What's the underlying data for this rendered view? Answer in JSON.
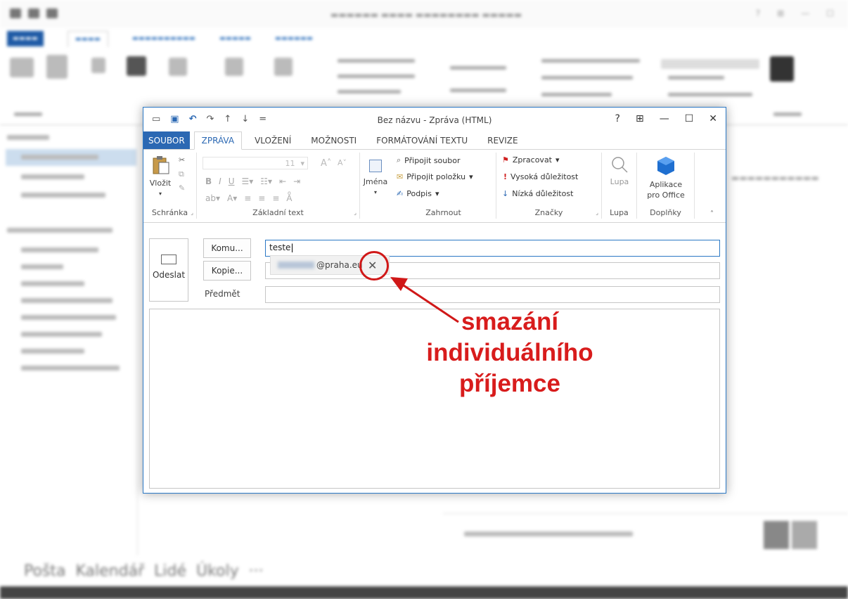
{
  "message_window": {
    "title": "Bez názvu - Zpráva (HTML)",
    "controls": {
      "help": "?",
      "ribbon_display": "⊞",
      "minimize": "—",
      "maximize": "☐",
      "close": "✕"
    },
    "tabs": [
      {
        "label": "SOUBOR",
        "active": false
      },
      {
        "label": "ZPRÁVA",
        "active": true
      },
      {
        "label": "VLOŽENÍ",
        "active": false
      },
      {
        "label": "MOŽNOSTI",
        "active": false
      },
      {
        "label": "FORMÁTOVÁNÍ TEXTU",
        "active": false
      },
      {
        "label": "REVIZE",
        "active": false
      }
    ],
    "ribbon": {
      "clipboard": {
        "label": "Schránka",
        "paste": "Vložit"
      },
      "basic_text": {
        "label": "Základní text",
        "font_size": "11"
      },
      "names": {
        "label": "Jména"
      },
      "include": {
        "label": "Zahrnout",
        "attach_file": "Připojit soubor",
        "attach_item": "Připojit položku",
        "signature": "Podpis"
      },
      "tags": {
        "label": "Značky",
        "follow_up": "Zpracovat",
        "high_importance": "Vysoká důležitost",
        "low_importance": "Nízká důležitost"
      },
      "zoom": {
        "label": "Lupa",
        "button": "Lupa"
      },
      "addins": {
        "label": "Doplňky",
        "apps_line1": "Aplikace",
        "apps_line2": "pro Office"
      }
    },
    "form": {
      "send": "Odeslat",
      "to_button": "Komu...",
      "to_value": "teste",
      "cc_button": "Kopie...",
      "subject_label": "Předmět",
      "subject_value": "",
      "suggestion_domain": "@praha.eu"
    }
  },
  "annotation": {
    "line1": "smazání",
    "line2": "individuálního",
    "line3": "příjemce",
    "color": "#d81c1c"
  },
  "background": {
    "bottom_nav": [
      "Pošta",
      "Kalendář",
      "Lidé",
      "Úkoly",
      "···"
    ]
  }
}
